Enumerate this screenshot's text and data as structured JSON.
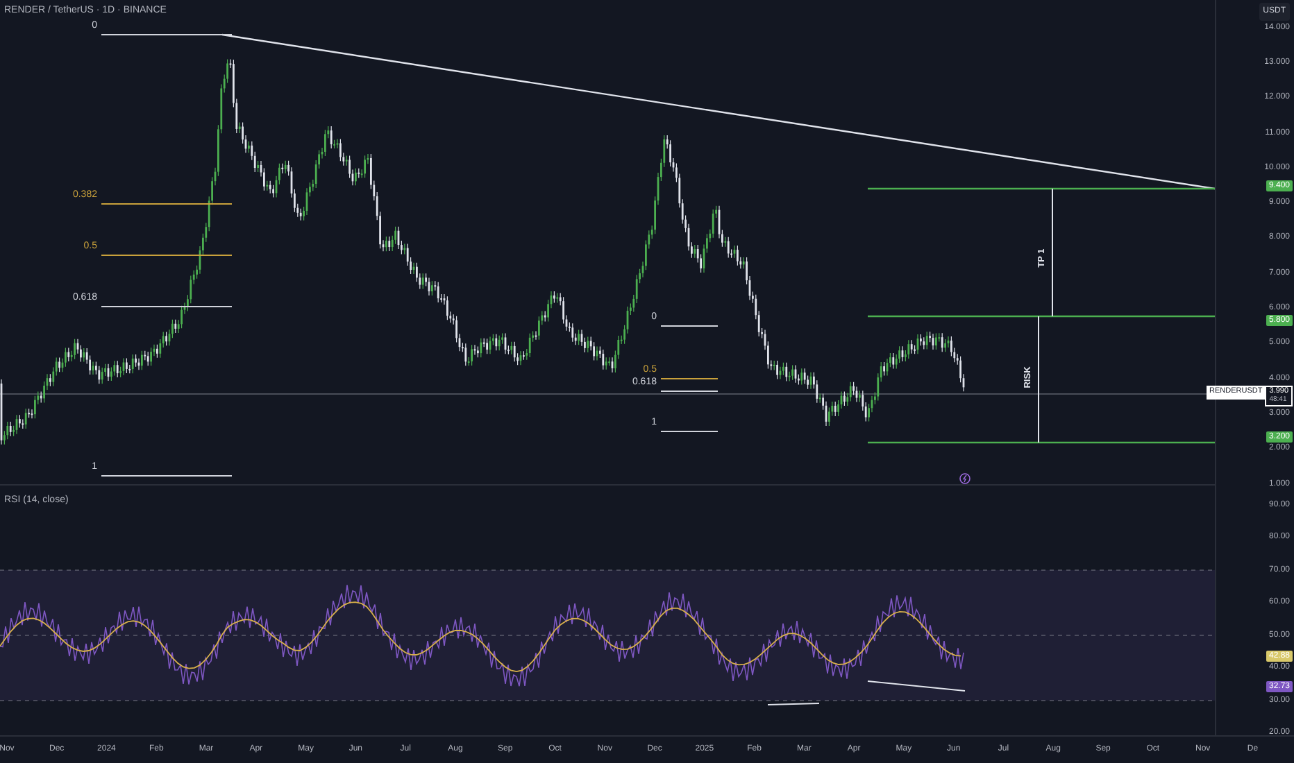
{
  "header": {
    "title": "RENDER / TetherUS · 1D · BINANCE",
    "currency": "USDT"
  },
  "price_axis": {
    "ticks": [
      "14.000",
      "13.000",
      "12.000",
      "11.000",
      "10.000",
      "9.000",
      "8.000",
      "7.000",
      "6.000",
      "5.000",
      "4.000",
      "3.000",
      "2.000",
      "1.000"
    ]
  },
  "fib_retracements": [
    {
      "levels": [
        {
          "label": "0",
          "color": "#d1d4dc"
        },
        {
          "label": "0.382",
          "color": "#c9a13b"
        },
        {
          "label": "0.5",
          "color": "#c9a13b"
        },
        {
          "label": "0.618",
          "color": "#d1d4dc"
        },
        {
          "label": "1",
          "color": "#d1d4dc"
        }
      ]
    },
    {
      "levels": [
        {
          "label": "0",
          "color": "#d1d4dc"
        },
        {
          "label": "0.5",
          "color": "#c9a13b"
        },
        {
          "label": "0.618",
          "color": "#d1d4dc"
        },
        {
          "label": "1",
          "color": "#d1d4dc"
        }
      ]
    }
  ],
  "trade_plan": {
    "price_badges": [
      "9.400",
      "5.800",
      "3.200"
    ],
    "measures": [
      {
        "label": "TP 1"
      },
      {
        "label": "RISK"
      }
    ]
  },
  "current_price": {
    "symbol": "RENDERUSDT",
    "price": "3.990",
    "countdown": "48:41"
  },
  "rsi": {
    "title": "RSI (14, close)",
    "ticks": [
      "90.00",
      "80.00",
      "70.00",
      "60.00",
      "50.00",
      "40.00",
      "30.00",
      "20.00"
    ],
    "value_badges": [
      {
        "text": "42.88",
        "color": "#d8c86a"
      },
      {
        "text": "32.73",
        "color": "#7e57c2"
      }
    ]
  },
  "time_axis": {
    "labels": [
      "Nov",
      "Dec",
      "2024",
      "Feb",
      "Mar",
      "Apr",
      "May",
      "Jun",
      "Jul",
      "Aug",
      "Sep",
      "Oct",
      "Nov",
      "Dec",
      "2025",
      "Feb",
      "Mar",
      "Apr",
      "May",
      "Jun",
      "Jul",
      "Aug",
      "Sep",
      "Oct",
      "Nov",
      "De"
    ]
  }
}
